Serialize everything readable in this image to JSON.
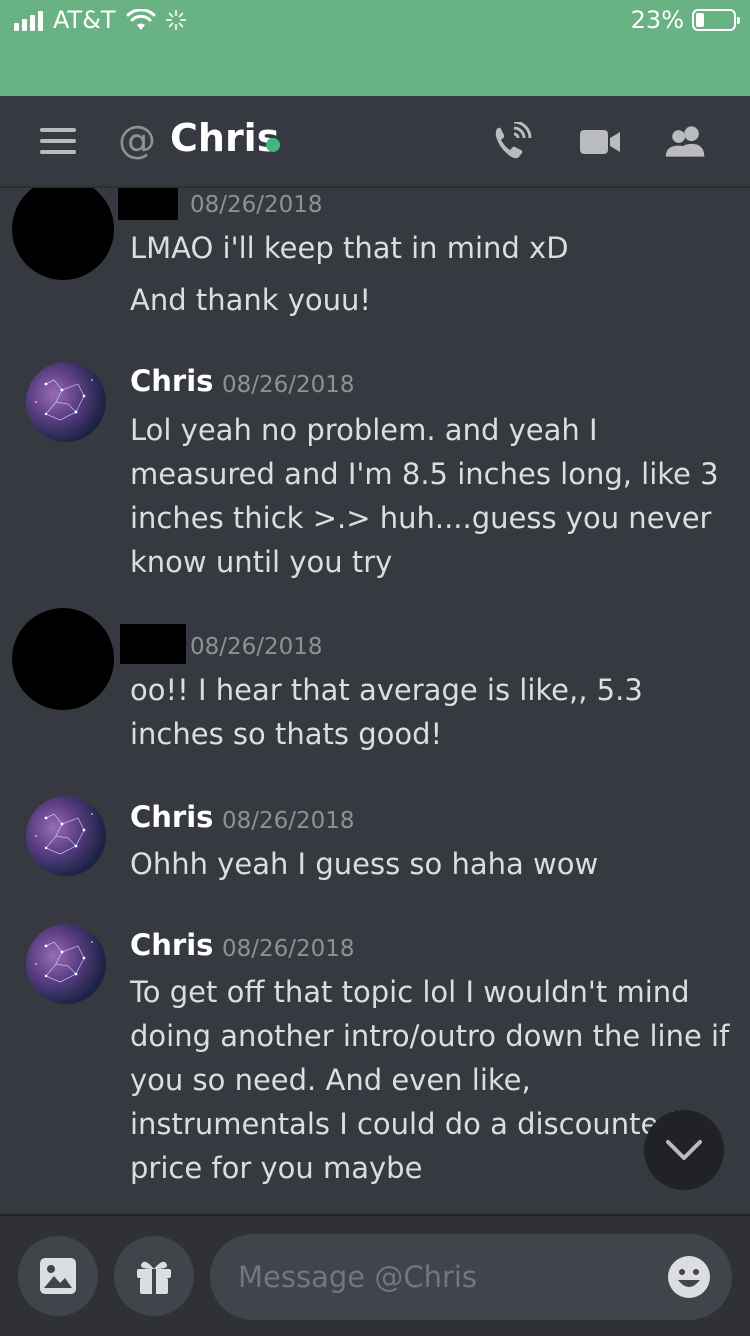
{
  "status_bar": {
    "carrier": "AT&T",
    "battery": "23%",
    "battery_level": 0.23
  },
  "header": {
    "prefix_icon": "at-icon",
    "title": "Chris",
    "status": "online"
  },
  "messages": [
    {
      "author": "",
      "redacted": true,
      "timestamp": "08/26/2018",
      "lines": [
        "LMAO i'll keep that in mind xD",
        "And thank youu!"
      ]
    },
    {
      "author": "Chris",
      "timestamp": "08/26/2018",
      "text": "Lol yeah no problem. and yeah I measured and I'm 8.5 inches long, like 3 inches thick >.> huh....guess you never know until you try"
    },
    {
      "author": "",
      "redacted": true,
      "timestamp": "08/26/2018",
      "text": "oo!! I hear that average is like,, 5.3 inches so thats good!"
    },
    {
      "author": "Chris",
      "timestamp": "08/26/2018",
      "text": "Ohhh yeah I guess so haha wow"
    },
    {
      "author": "Chris",
      "timestamp": "08/26/2018",
      "text": "To get off that topic lol I wouldn't mind doing another intro/outro down the line if you so need. And even like, instrumentals I could do a discounted price for you maybe"
    }
  ],
  "composer": {
    "placeholder": "Message @Chris"
  },
  "colors": {
    "status_bar": "#68b283",
    "background": "#36393f",
    "online": "#43b581"
  }
}
